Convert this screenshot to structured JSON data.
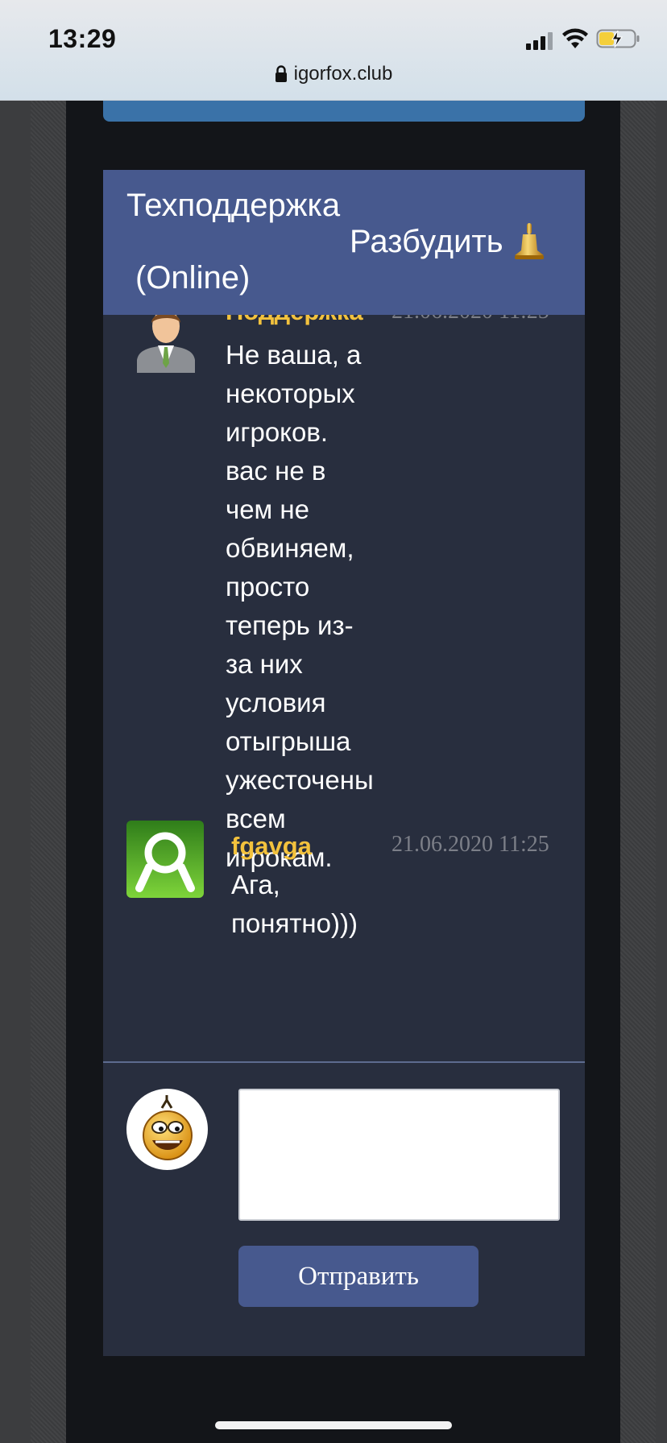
{
  "status_bar": {
    "time": "13:29",
    "url": "igorfox.club"
  },
  "chat": {
    "header": {
      "title": "Техподдержка",
      "status": "(Online)",
      "wake_label": "Разбудить"
    },
    "messages": [
      {
        "author": "Поддержка",
        "time": "21.06.2020 11:25",
        "text": "Не ваша, а\nнекоторых\nигроков.\nвас не в\nчем не\nобвиняем,\nпросто\nтеперь из-\nза них\nусловия\nотыгрыша\nужесточены\nвсем\nигрокам."
      },
      {
        "author": "fgavga",
        "time": "21.06.2020 11:25",
        "text": "Ага,\nпонятно)))"
      }
    ],
    "composer": {
      "input_value": "",
      "send_label": "Отправить"
    }
  },
  "colors": {
    "header_blue": "#47598e",
    "card_bg": "#282e3e",
    "author_yellow": "#f3c23d",
    "page_dark": "#131519"
  },
  "icons": [
    "lock-icon",
    "cellular-signal-icon",
    "wifi-icon",
    "battery-charging-icon",
    "bell-icon",
    "support-agent-avatar",
    "user-avatar",
    "smiley-avatar"
  ]
}
